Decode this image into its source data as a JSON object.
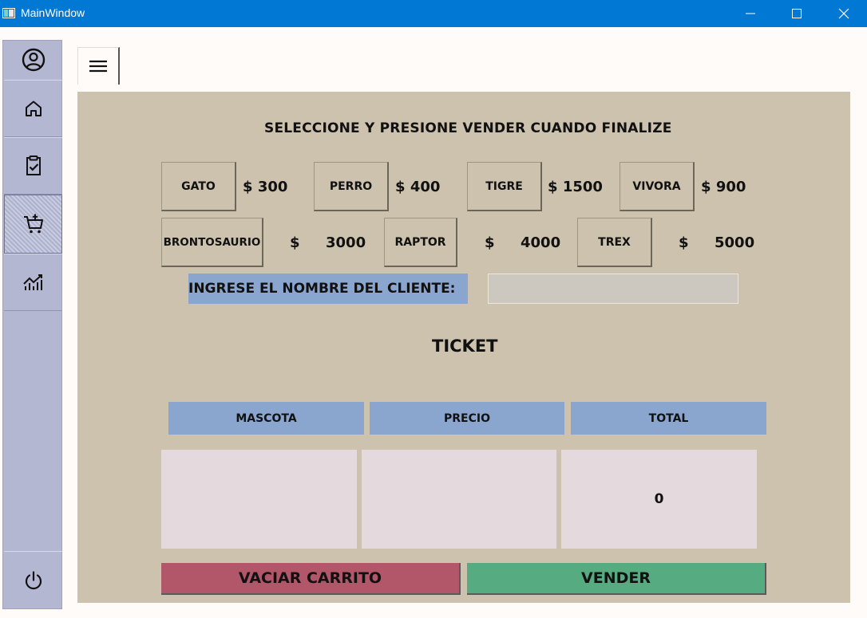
{
  "window": {
    "title": "MainWindow"
  },
  "sidebar": {
    "items": [
      {
        "icon": "user-circle-icon"
      },
      {
        "icon": "home-icon"
      },
      {
        "icon": "clipboard-check-icon"
      },
      {
        "icon": "cart-add-icon"
      },
      {
        "icon": "chart-icon"
      },
      {
        "icon": "power-icon"
      }
    ]
  },
  "header": {
    "menu_icon": "hamburger-icon"
  },
  "main": {
    "heading": "SELECCIONE Y PRESIONE VENDER CUANDO FINALIZE",
    "currency": "$",
    "pets": [
      {
        "name": "GATO",
        "price": "300"
      },
      {
        "name": "PERRO",
        "price": "400"
      },
      {
        "name": "TIGRE",
        "price": "1500"
      },
      {
        "name": "VIVORA",
        "price": "900"
      },
      {
        "name": "BRONTOSAURIO",
        "price": "3000"
      },
      {
        "name": "RAPTOR",
        "price": "4000"
      },
      {
        "name": "TREX",
        "price": "5000"
      }
    ],
    "client_label": "INGRESE EL NOMBRE DEL CLIENTE:",
    "client_value": "",
    "ticket": {
      "title": "TICKET",
      "columns": [
        "MASCOTA",
        "PRECIO",
        "TOTAL"
      ],
      "values": {
        "mascota": "",
        "precio": "",
        "total": "0"
      }
    },
    "buttons": {
      "empty_cart": "VACIAR CARRITO",
      "sell": "VENDER"
    }
  },
  "colors": {
    "titlebar": "#0078d4",
    "sidebar": "#b4b7d2",
    "panel": "#ccc2ad",
    "header_blue": "#8aa6cf",
    "cell": "#e4dadd",
    "empty_cart": "#b2566a",
    "sell": "#57ab80"
  }
}
